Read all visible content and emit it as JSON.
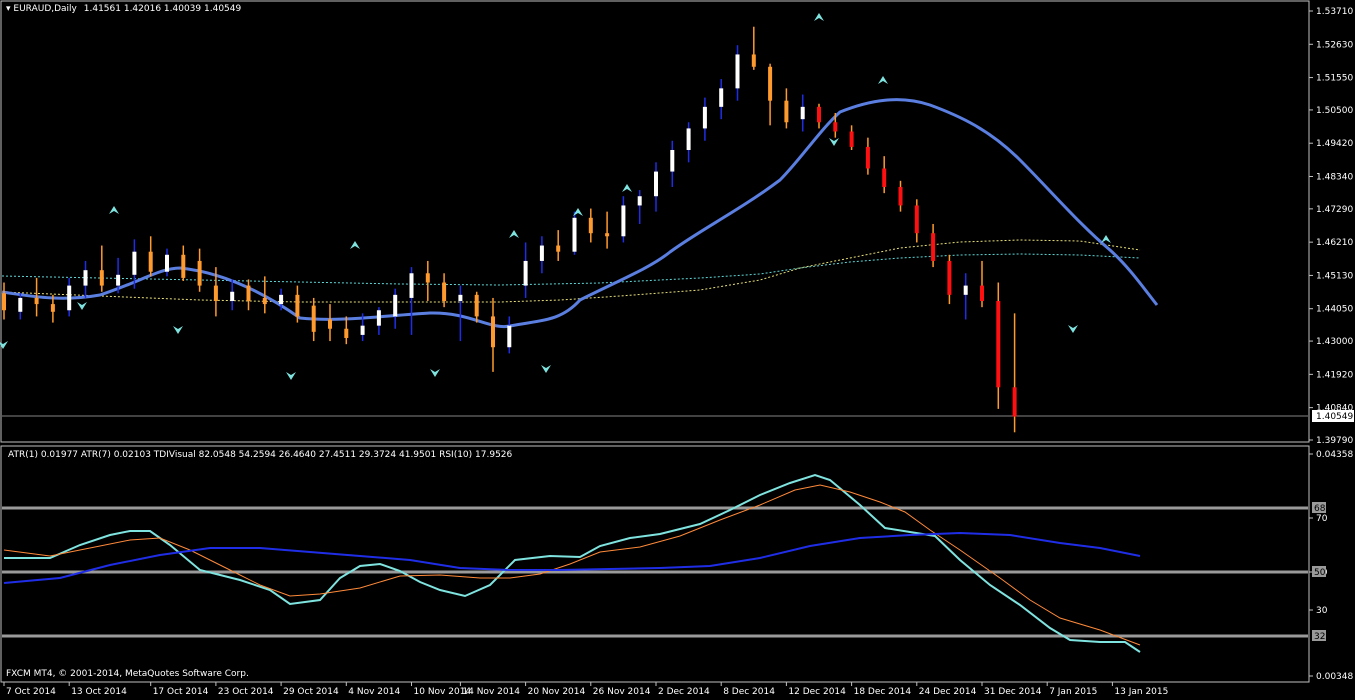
{
  "header": {
    "symbol": "EURAUD,Daily",
    "ohlc": "1.41561 1.42016 1.40039 1.40549"
  },
  "indicator_header": "ATR(1) 0.01977  ATR(7) 0.02103  TDIVisual 82.0548 54.2594 26.4640 27.4511 29.3724 41.9501  RSI(10) 17.9526",
  "copyright": "FXCM MT4, © 2001-2014, MetaQuotes Software Corp.",
  "chart_data": {
    "type": "candlestick",
    "symbol": "EURAUD",
    "timeframe": "Daily",
    "current_price": 1.40549,
    "price_axis_ticks": [
      "1.53710",
      "1.52630",
      "1.51550",
      "1.50500",
      "1.49420",
      "1.48340",
      "1.47290",
      "1.46210",
      "1.45130",
      "1.44050",
      "1.43000",
      "1.41920",
      "1.40840",
      "1.39790"
    ],
    "price_ylim": [
      1.3955,
      1.539
    ],
    "indicator_axis_ticks": [
      "0.04358",
      "70",
      "50",
      "30",
      "0.00348"
    ],
    "indicator_levels": [
      "68",
      "50",
      "32"
    ],
    "x_tick_labels": [
      "7 Oct 2014",
      "13 Oct 2014",
      "17 Oct 2014",
      "23 Oct 2014",
      "29 Oct 2014",
      "4 Nov 2014",
      "10 Nov 2014",
      "14 Nov 2014",
      "20 Nov 2014",
      "26 Nov 2014",
      "2 Dec 2014",
      "8 Dec 2014",
      "12 Dec 2014",
      "18 Dec 2014",
      "24 Dec 2014",
      "31 Dec 2014",
      "7 Jan 2015",
      "13 Jan 2015"
    ],
    "x_tick_bar_index": [
      0,
      4,
      9,
      13,
      17,
      21,
      25,
      28,
      32,
      36,
      40,
      44,
      48,
      52,
      56,
      60,
      64,
      68
    ],
    "candles": [
      {
        "o": 1.4455,
        "h": 1.449,
        "l": 1.437,
        "c": 1.44
      },
      {
        "o": 1.4395,
        "h": 1.4455,
        "l": 1.437,
        "c": 1.444
      },
      {
        "o": 1.444,
        "h": 1.4505,
        "l": 1.438,
        "c": 1.442
      },
      {
        "o": 1.442,
        "h": 1.445,
        "l": 1.436,
        "c": 1.4395
      },
      {
        "o": 1.44,
        "h": 1.4505,
        "l": 1.438,
        "c": 1.448
      },
      {
        "o": 1.448,
        "h": 1.456,
        "l": 1.444,
        "c": 1.453
      },
      {
        "o": 1.453,
        "h": 1.461,
        "l": 1.446,
        "c": 1.448
      },
      {
        "o": 1.448,
        "h": 1.457,
        "l": 1.4455,
        "c": 1.4515
      },
      {
        "o": 1.4515,
        "h": 1.463,
        "l": 1.447,
        "c": 1.459
      },
      {
        "o": 1.459,
        "h": 1.464,
        "l": 1.451,
        "c": 1.4525
      },
      {
        "o": 1.4525,
        "h": 1.46,
        "l": 1.451,
        "c": 1.458
      },
      {
        "o": 1.458,
        "h": 1.461,
        "l": 1.4495,
        "c": 1.4505
      },
      {
        "o": 1.456,
        "h": 1.46,
        "l": 1.446,
        "c": 1.448
      },
      {
        "o": 1.448,
        "h": 1.454,
        "l": 1.438,
        "c": 1.443
      },
      {
        "o": 1.443,
        "h": 1.45,
        "l": 1.44,
        "c": 1.446
      },
      {
        "o": 1.448,
        "h": 1.45,
        "l": 1.44,
        "c": 1.443
      },
      {
        "o": 1.444,
        "h": 1.451,
        "l": 1.439,
        "c": 1.442
      },
      {
        "o": 1.442,
        "h": 1.447,
        "l": 1.44,
        "c": 1.445
      },
      {
        "o": 1.445,
        "h": 1.448,
        "l": 1.436,
        "c": 1.438
      },
      {
        "o": 1.4415,
        "h": 1.444,
        "l": 1.43,
        "c": 1.433
      },
      {
        "o": 1.437,
        "h": 1.442,
        "l": 1.43,
        "c": 1.434
      },
      {
        "o": 1.434,
        "h": 1.438,
        "l": 1.429,
        "c": 1.431
      },
      {
        "o": 1.432,
        "h": 1.439,
        "l": 1.43,
        "c": 1.435
      },
      {
        "o": 1.435,
        "h": 1.441,
        "l": 1.432,
        "c": 1.44
      },
      {
        "o": 1.438,
        "h": 1.447,
        "l": 1.434,
        "c": 1.445
      },
      {
        "o": 1.444,
        "h": 1.454,
        "l": 1.432,
        "c": 1.452
      },
      {
        "o": 1.452,
        "h": 1.456,
        "l": 1.443,
        "c": 1.449
      },
      {
        "o": 1.449,
        "h": 1.452,
        "l": 1.441,
        "c": 1.443
      },
      {
        "o": 1.443,
        "h": 1.448,
        "l": 1.43,
        "c": 1.445
      },
      {
        "o": 1.445,
        "h": 1.446,
        "l": 1.436,
        "c": 1.438
      },
      {
        "o": 1.438,
        "h": 1.444,
        "l": 1.42,
        "c": 1.428
      },
      {
        "o": 1.428,
        "h": 1.438,
        "l": 1.426,
        "c": 1.435
      }
    ],
    "levels_note": "",
    "legend": "top-left"
  }
}
